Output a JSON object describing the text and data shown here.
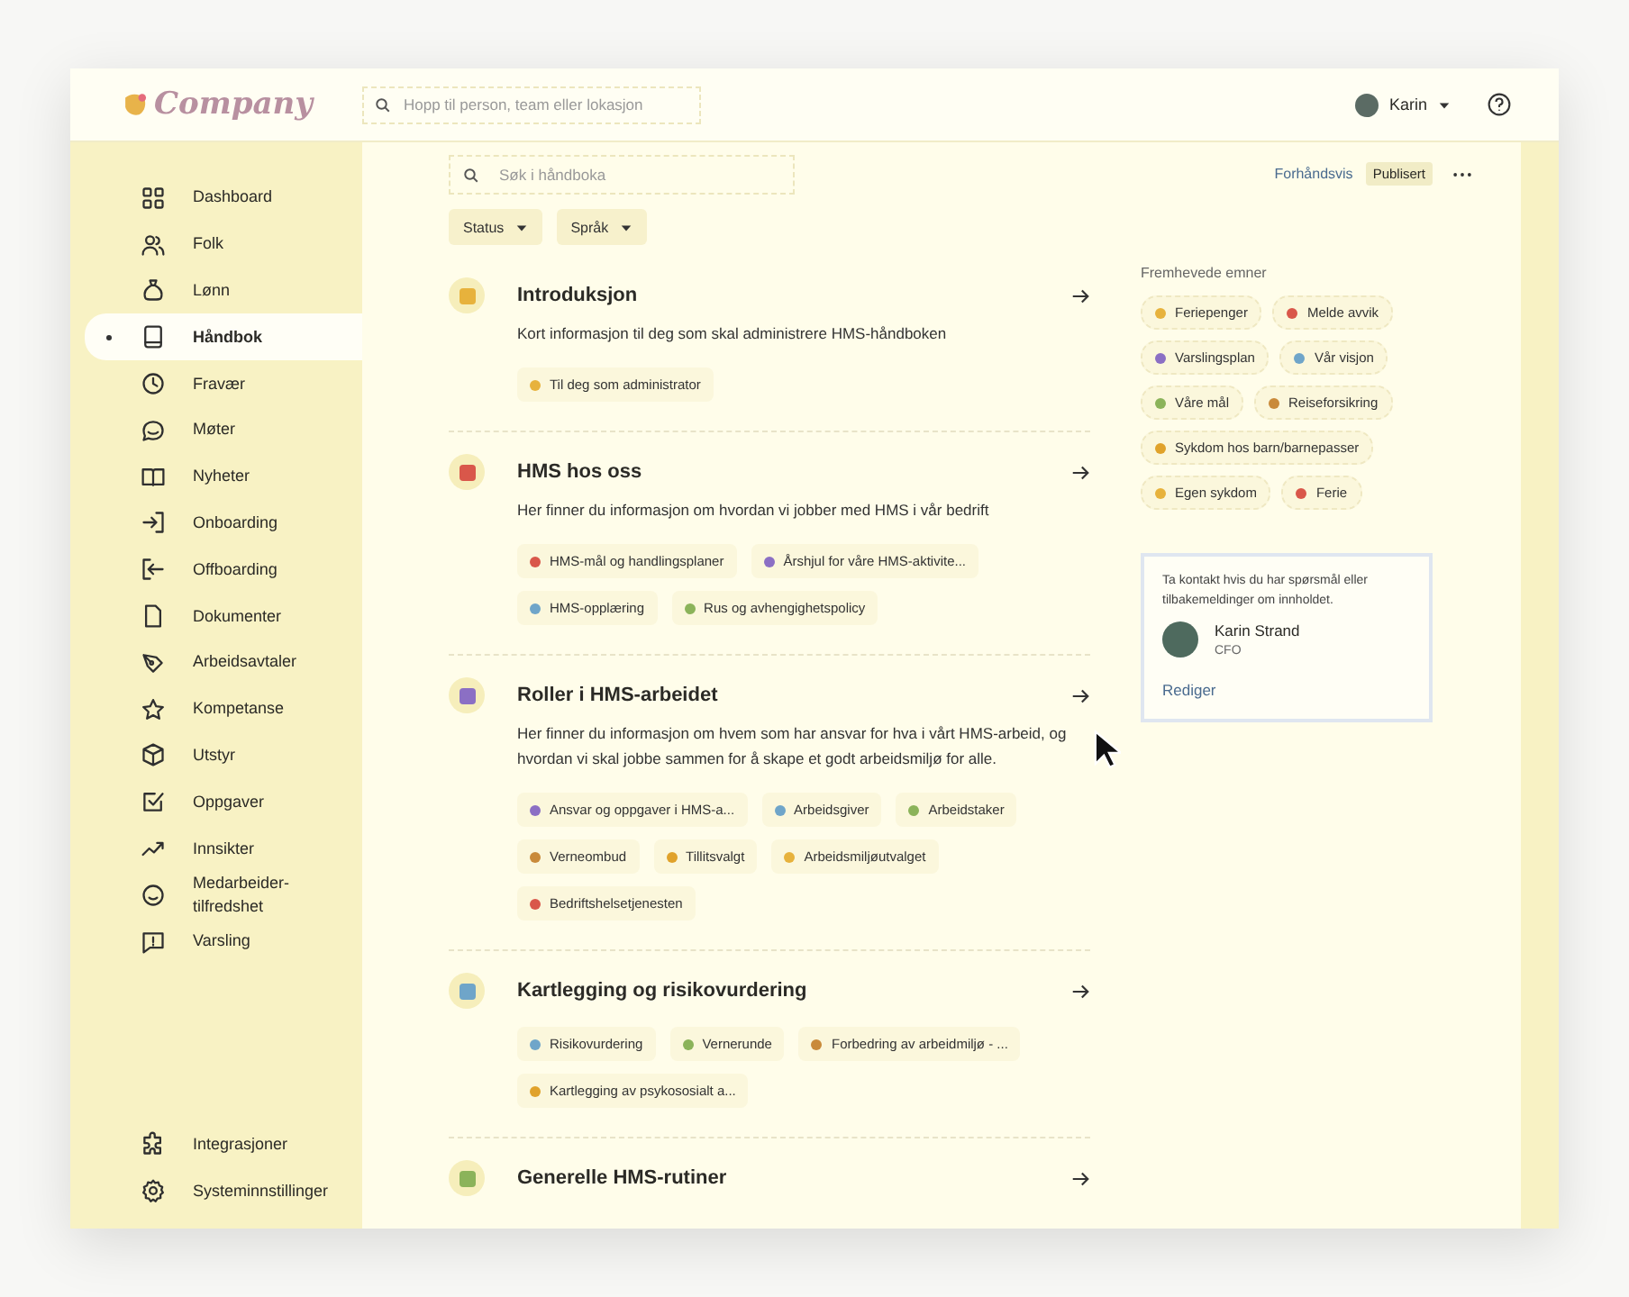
{
  "header": {
    "logo": "Company",
    "search_placeholder": "Hopp til person, team eller lokasjon",
    "user": "Karin"
  },
  "sidebar": {
    "items": [
      {
        "label": "Dashboard",
        "selected": false
      },
      {
        "label": "Folk",
        "selected": false
      },
      {
        "label": "Lønn",
        "selected": false
      },
      {
        "label": "Håndbok",
        "selected": true
      },
      {
        "label": "Fravær",
        "selected": false
      },
      {
        "label": "Møter",
        "selected": false
      },
      {
        "label": "Nyheter",
        "selected": false
      },
      {
        "label": "Onboarding",
        "selected": false
      },
      {
        "label": "Offboarding",
        "selected": false
      },
      {
        "label": "Dokumenter",
        "selected": false
      },
      {
        "label": "Arbeidsavtaler",
        "selected": false
      },
      {
        "label": "Kompetanse",
        "selected": false
      },
      {
        "label": "Utstyr",
        "selected": false
      },
      {
        "label": "Oppgaver",
        "selected": false
      },
      {
        "label": "Innsikter",
        "selected": false
      },
      {
        "label": "Medarbeider-\ntilfredshet",
        "selected": false
      },
      {
        "label": "Varsling",
        "selected": false
      }
    ],
    "bottom_items": [
      {
        "label": "Integrasjoner",
        "selected": false
      },
      {
        "label": "Systeminnstillinger",
        "selected": false
      }
    ]
  },
  "toolbar": {
    "search_placeholder": "Søk i håndboka",
    "filters": [
      "Status",
      "Språk"
    ],
    "preview": "Forhåndsvis",
    "status": "Publisert"
  },
  "sections": [
    {
      "title": "Introduksjon",
      "description": "Kort informasjon til deg som skal administrere HMS-håndboken",
      "links": [
        "Til deg som administrator"
      ]
    },
    {
      "title": "HMS hos oss",
      "description": "Her finner du informasjon om hvordan vi jobber med HMS i vår bedrift",
      "links": [
        "HMS-mål og handlingsplaner",
        "Årshjul for våre HMS-aktivite...",
        "HMS-opplæring",
        "Rus og avhengighetspolicy"
      ]
    },
    {
      "title": "Roller i HMS-arbeidet",
      "description": "Her finner du informasjon om hvem som har ansvar for hva i vårt HMS-arbeid, og hvordan vi skal jobbe sammen for å skape et godt arbeidsmiljø for alle.",
      "links": [
        "Ansvar og oppgaver i HMS-a...",
        "Arbeidsgiver",
        "Arbeidstaker",
        "Verneombud",
        "Tillitsvalgt",
        "Arbeidsmiljøutvalget",
        "Bedriftshelsetjenesten"
      ]
    },
    {
      "title": "Kartlegging og risikovurdering",
      "links": [
        "Risikovurdering",
        "Vernerunde",
        "Forbedring av arbeidmiljø - ...",
        "Kartlegging av psykososialt a..."
      ]
    },
    {
      "title": "Generelle HMS-rutiner"
    }
  ],
  "featured": {
    "title": "Fremhevede emner",
    "topics": [
      "Feriepenger",
      "Melde avvik",
      "Varslingsplan",
      "Vår visjon",
      "Våre mål",
      "Reiseforsikring",
      "Sykdom hos barn/barnepasser",
      "Egen sykdom",
      "Ferie"
    ]
  },
  "contact": {
    "text": "Ta kontakt hvis du har spørsmål eller tilbakemeldinger om innholdet.",
    "name": "Karin Strand",
    "role": "CFO",
    "edit": "Rediger"
  }
}
